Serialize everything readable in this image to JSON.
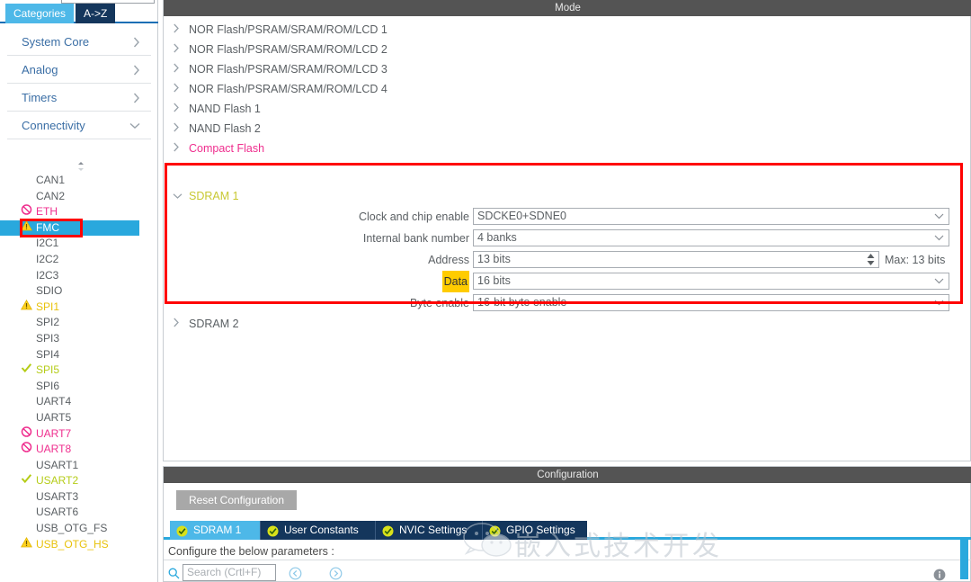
{
  "left_panel": {
    "tabs": [
      {
        "label": "Categories",
        "active": true
      },
      {
        "label": "A->Z",
        "active": false
      }
    ],
    "categories": [
      {
        "label": "System Core",
        "chevron": "chevron-right-icon"
      },
      {
        "label": "Analog",
        "chevron": "chevron-right-icon"
      },
      {
        "label": "Timers",
        "chevron": "chevron-right-icon"
      },
      {
        "label": "Connectivity",
        "chevron": "chevron-down-icon"
      }
    ],
    "peripherals": [
      {
        "label": "CAN1",
        "status": "none",
        "selected": false
      },
      {
        "label": "CAN2",
        "status": "none",
        "selected": false
      },
      {
        "label": "ETH",
        "status": "deny",
        "selected": false
      },
      {
        "label": "FMC",
        "status": "warn",
        "selected": true
      },
      {
        "label": "I2C1",
        "status": "none",
        "selected": false
      },
      {
        "label": "I2C2",
        "status": "none",
        "selected": false
      },
      {
        "label": "I2C3",
        "status": "none",
        "selected": false
      },
      {
        "label": "SDIO",
        "status": "none",
        "selected": false
      },
      {
        "label": "SPI1",
        "status": "warn",
        "selected": false
      },
      {
        "label": "SPI2",
        "status": "none",
        "selected": false
      },
      {
        "label": "SPI3",
        "status": "none",
        "selected": false
      },
      {
        "label": "SPI4",
        "status": "none",
        "selected": false
      },
      {
        "label": "SPI5",
        "status": "ok",
        "selected": false
      },
      {
        "label": "SPI6",
        "status": "none",
        "selected": false
      },
      {
        "label": "UART4",
        "status": "none",
        "selected": false
      },
      {
        "label": "UART5",
        "status": "none",
        "selected": false
      },
      {
        "label": "UART7",
        "status": "deny",
        "selected": false
      },
      {
        "label": "UART8",
        "status": "deny",
        "selected": false
      },
      {
        "label": "USART1",
        "status": "none",
        "selected": false
      },
      {
        "label": "USART2",
        "status": "ok",
        "selected": false
      },
      {
        "label": "USART3",
        "status": "none",
        "selected": false
      },
      {
        "label": "USART6",
        "status": "none",
        "selected": false
      },
      {
        "label": "USB_OTG_FS",
        "status": "none",
        "selected": false
      },
      {
        "label": "USB_OTG_HS",
        "status": "warn",
        "selected": false
      }
    ]
  },
  "mode_panel": {
    "title": "Mode",
    "tree_items": [
      {
        "label": "NOR Flash/PSRAM/SRAM/ROM/LCD 1",
        "expanded": false,
        "color": "normal"
      },
      {
        "label": "NOR Flash/PSRAM/SRAM/ROM/LCD 2",
        "expanded": false,
        "color": "normal"
      },
      {
        "label": "NOR Flash/PSRAM/SRAM/ROM/LCD 3",
        "expanded": false,
        "color": "normal"
      },
      {
        "label": "NOR Flash/PSRAM/SRAM/ROM/LCD 4",
        "expanded": false,
        "color": "normal"
      },
      {
        "label": "NAND Flash 1",
        "expanded": false,
        "color": "normal"
      },
      {
        "label": "NAND Flash 2",
        "expanded": false,
        "color": "normal"
      },
      {
        "label": "Compact Flash",
        "expanded": false,
        "color": "pink"
      }
    ],
    "sdram1": {
      "label": "SDRAM 1",
      "expanded": true,
      "fields": [
        {
          "label": "Clock and chip enable",
          "value": "SDCKE0+SDNE0",
          "type": "combo",
          "highlight": false
        },
        {
          "label": "Internal bank number",
          "value": "4 banks",
          "type": "combo",
          "highlight": false
        },
        {
          "label": "Address",
          "value": "13 bits",
          "type": "spinner",
          "highlight": false,
          "note": "Max: 13 bits"
        },
        {
          "label": "Data",
          "value": "16 bits",
          "type": "combo",
          "highlight": true
        },
        {
          "label": "Byte enable",
          "value": "16-bit byte enable",
          "type": "combo",
          "highlight": false
        }
      ]
    },
    "sdram2": {
      "label": "SDRAM 2",
      "expanded": false
    }
  },
  "config_panel": {
    "title": "Configuration",
    "reset_button": "Reset Configuration",
    "tabs": [
      {
        "label": "SDRAM 1",
        "active": true
      },
      {
        "label": "User Constants",
        "active": false
      },
      {
        "label": "NVIC Settings",
        "active": false
      },
      {
        "label": "GPIO Settings",
        "active": false
      }
    ],
    "note": "Configure the below parameters :",
    "search_placeholder": "Search (Crtl+F)",
    "nav_prev": "prev-icon",
    "nav_next": "next-icon"
  },
  "watermark": {
    "text": "嵌入式技术开发"
  },
  "colors": {
    "accent_blue": "#29a8dd",
    "tab_light": "#4db8e8",
    "tab_dark": "#14365c",
    "header_gray": "#545454",
    "warn_yellow": "#e8c20a",
    "ok_green": "#b5cc18",
    "deny_pink": "#ef2e8e",
    "annotation_red": "#ff0000",
    "highlight_gold": "#ffcc00"
  }
}
